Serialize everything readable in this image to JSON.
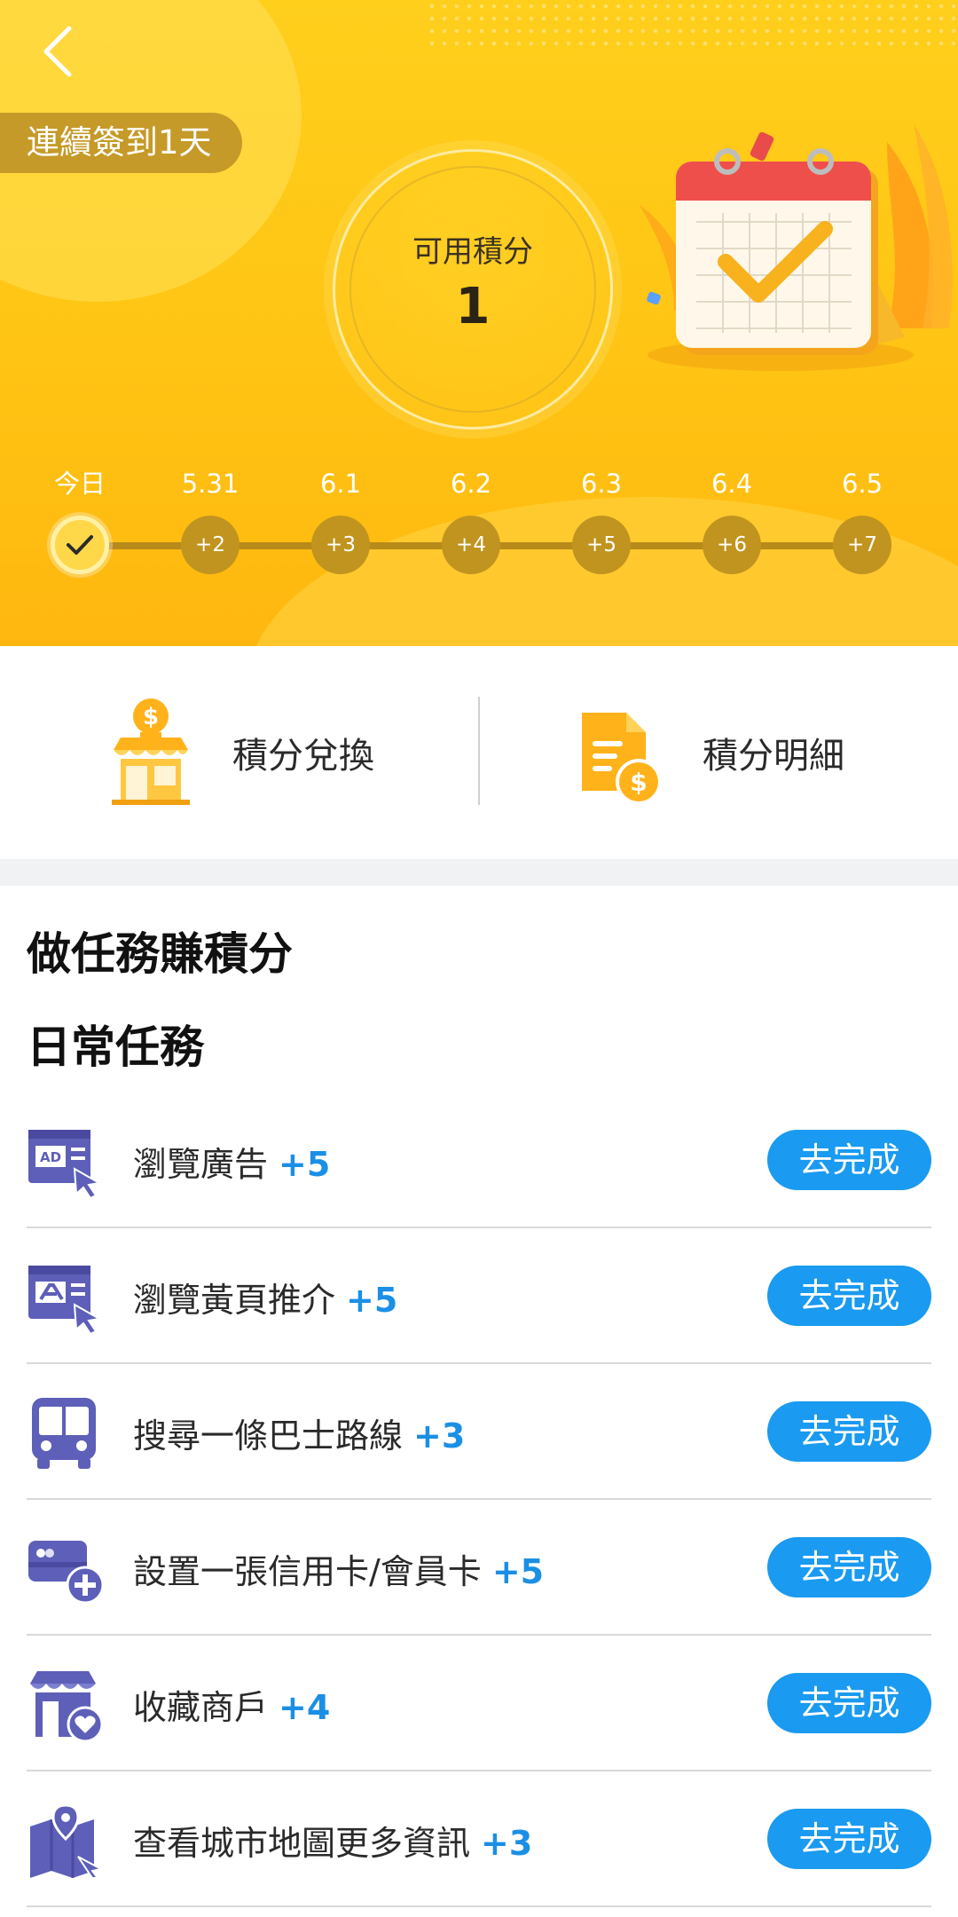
{
  "header": {
    "streak_label": "連續簽到1天",
    "points_label": "可用積分",
    "points_value": "1",
    "days": [
      {
        "label": "今日",
        "reward": "",
        "checked": true
      },
      {
        "label": "5.31",
        "reward": "+2",
        "checked": false
      },
      {
        "label": "6.1",
        "reward": "+3",
        "checked": false
      },
      {
        "label": "6.2",
        "reward": "+4",
        "checked": false
      },
      {
        "label": "6.3",
        "reward": "+5",
        "checked": false
      },
      {
        "label": "6.4",
        "reward": "+6",
        "checked": false
      },
      {
        "label": "6.5",
        "reward": "+7",
        "checked": false
      }
    ]
  },
  "actions": {
    "redeem_label": "積分兌換",
    "details_label": "積分明細"
  },
  "tasks_section": {
    "title": "做任務賺積分",
    "subtitle": "日常任務",
    "items": [
      {
        "label": "瀏覽廣告",
        "points": "+5",
        "button": "去完成",
        "icon": "ad-browser-icon"
      },
      {
        "label": "瀏覽黃頁推介",
        "points": "+5",
        "button": "去完成",
        "icon": "yellow-pages-browser-icon"
      },
      {
        "label": "搜尋一條巴士路線",
        "points": "+3",
        "button": "去完成",
        "icon": "bus-icon"
      },
      {
        "label": "設置一張信用卡/會員卡",
        "points": "+5",
        "button": "去完成",
        "icon": "add-card-icon"
      },
      {
        "label": "收藏商戶",
        "points": "+4",
        "button": "去完成",
        "icon": "favorite-shop-icon"
      },
      {
        "label": "查看城市地圖更多資訊",
        "points": "+3",
        "button": "去完成",
        "icon": "city-map-icon"
      }
    ]
  },
  "colors": {
    "header_yellow": "#ffc414",
    "accent_blue": "#1a9af0",
    "points_blue": "#1b8fe6",
    "icon_purple": "#5d5fb8"
  }
}
